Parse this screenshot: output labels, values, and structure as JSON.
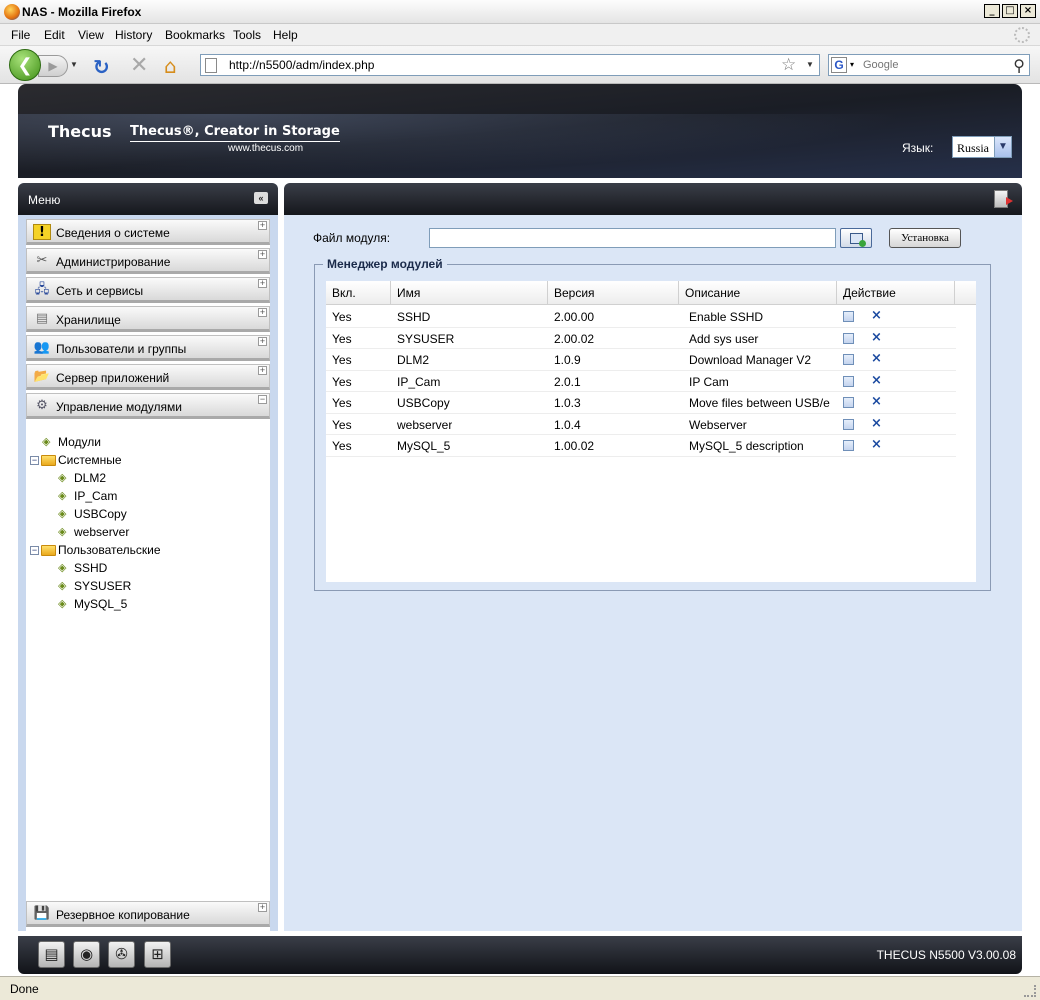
{
  "window": {
    "title": "NAS - Mozilla Firefox"
  },
  "menubar": [
    "File",
    "Edit",
    "View",
    "History",
    "Bookmarks",
    "Tools",
    "Help"
  ],
  "nav": {
    "url": "http://n5500/adm/index.php",
    "search_placeholder": "Google"
  },
  "header": {
    "logo": "Thecus",
    "slogan": "Thecus®, Creator in Storage",
    "site": "www.thecus.com",
    "lang_label": "Язык:",
    "lang_value": "Russia"
  },
  "sidebar": {
    "title": "Меню",
    "collapse_glyph": "«",
    "categories": [
      {
        "label": "Сведения о системе",
        "icon": "!",
        "toggle": "+"
      },
      {
        "label": "Администрирование",
        "icon": "✂",
        "toggle": "+"
      },
      {
        "label": "Сеть и сервисы",
        "icon": "🖧",
        "toggle": "+"
      },
      {
        "label": "Хранилище",
        "icon": "▤",
        "toggle": "+"
      },
      {
        "label": "Пользователи и группы",
        "icon": "👥",
        "toggle": "+"
      },
      {
        "label": "Сервер приложений",
        "icon": "📂",
        "toggle": "+"
      },
      {
        "label": "Управление модулями",
        "icon": "⚙",
        "toggle": "−"
      }
    ],
    "tree": {
      "modules": "Модули",
      "system": "Системные",
      "system_items": [
        "DLM2",
        "IP_Cam",
        "USBCopy",
        "webserver"
      ],
      "user": "Пользовательские",
      "user_items": [
        "SSHD",
        "SYSUSER",
        "MySQL_5"
      ]
    },
    "backup": {
      "label": "Резервное копирование",
      "icon": "💾",
      "toggle": "+"
    }
  },
  "main": {
    "file_label": "Файл модуля:",
    "install_label": "Установка",
    "manager_legend": "Менеджер модулей",
    "columns": [
      "Вкл.",
      "Имя",
      "Версия",
      "Описание",
      "Действие"
    ],
    "rows": [
      {
        "enabled": "Yes",
        "name": "SSHD",
        "version": "2.00.00",
        "desc": "Enable SSHD"
      },
      {
        "enabled": "Yes",
        "name": "SYSUSER",
        "version": "2.00.02",
        "desc": "Add sys user"
      },
      {
        "enabled": "Yes",
        "name": "DLM2",
        "version": "1.0.9",
        "desc": "Download Manager V2"
      },
      {
        "enabled": "Yes",
        "name": "IP_Cam",
        "version": "2.0.1",
        "desc": "IP Cam"
      },
      {
        "enabled": "Yes",
        "name": "USBCopy",
        "version": "1.0.3",
        "desc": "Move files between USB/e"
      },
      {
        "enabled": "Yes",
        "name": "webserver",
        "version": "1.0.4",
        "desc": "Webserver"
      },
      {
        "enabled": "Yes",
        "name": "MySQL_5",
        "version": "1.00.02",
        "desc": "MySQL_5 description"
      }
    ],
    "delete_glyph": "×"
  },
  "footer": {
    "version": "THECUS N5500 V3.00.08"
  },
  "status": {
    "text": "Done"
  },
  "colors": {
    "panel_bg": "#dbe6f6",
    "sidebar_bg": "#c9d8ee",
    "dark_bar": "#15171c",
    "link_blue": "#1b4aa0"
  }
}
